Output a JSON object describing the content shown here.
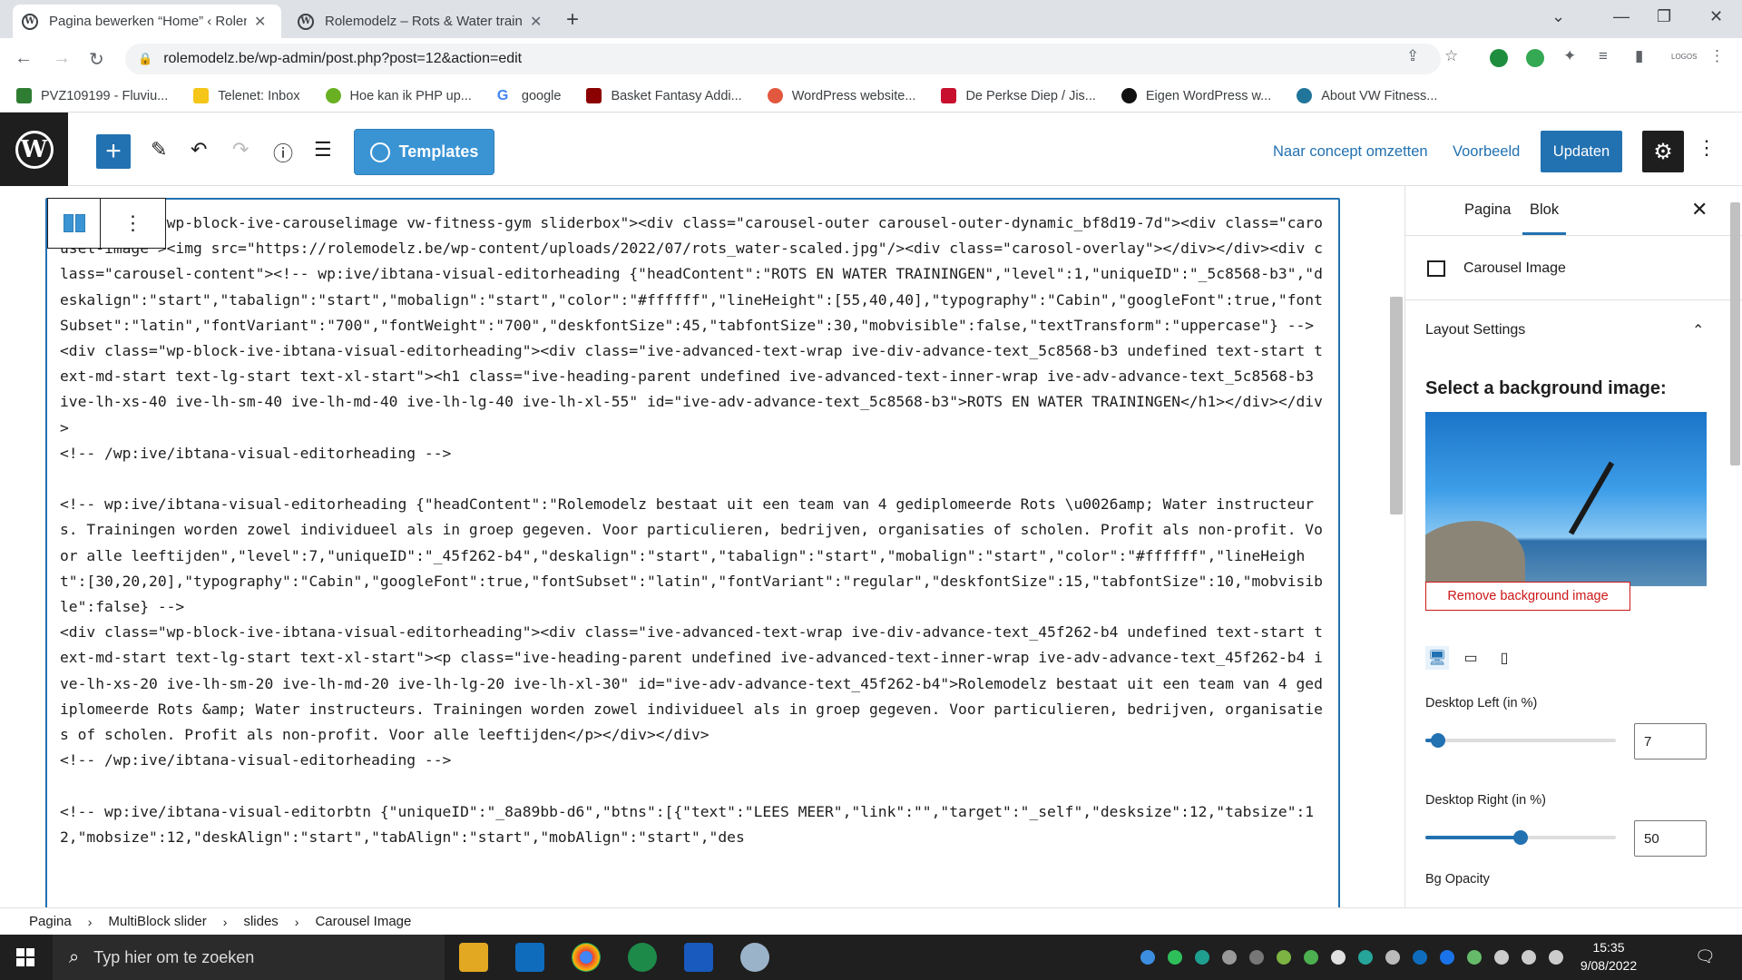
{
  "browser": {
    "tabs": [
      {
        "title": "Pagina bewerken “Home” ‹ Rolem",
        "active": true
      },
      {
        "title": "Rolemodelz – Rots & Water train",
        "active": false
      }
    ],
    "url": "rolemodelz.be/wp-admin/post.php?post=12&action=edit",
    "bookmarks": [
      {
        "label": "PVZ109199 - Fluviu...",
        "color": "#2e7d32"
      },
      {
        "label": "Telenet: Inbox",
        "color": "#f5c518"
      },
      {
        "label": "Hoe kan ik PHP up...",
        "color": "#6ab023"
      },
      {
        "label": "google",
        "color": "#4285f4"
      },
      {
        "label": "Basket Fantasy Addi...",
        "color": "#8b0000"
      },
      {
        "label": "WordPress website...",
        "color": "#e2583e"
      },
      {
        "label": "De Perkse Diep / Jis...",
        "color": "#c8102e"
      },
      {
        "label": "Eigen WordPress w...",
        "color": "#111111"
      },
      {
        "label": "About VW Fitness...",
        "color": "#21759b"
      }
    ]
  },
  "wp_toolbar": {
    "templates_label": "Templates",
    "draft_label": "Naar concept omzetten",
    "preview_label": "Voorbeeld",
    "update_label": "Updaten"
  },
  "editor": {
    "code": "<div class=\"wp-block-ive-carouselimage vw-fitness-gym sliderbox\"><div class=\"carousel-outer carousel-outer-dynamic_bf8d19-7d\"><div class=\"carousel-image\"><img src=\"https://rolemodelz.be/wp-content/uploads/2022/07/rots_water-scaled.jpg\"/><div class=\"carosol-overlay\"></div></div><div class=\"carousel-content\"><!-- wp:ive/ibtana-visual-editorheading {\"headContent\":\"ROTS EN WATER TRAININGEN\",\"level\":1,\"uniqueID\":\"_5c8568-b3\",\"deskalign\":\"start\",\"tabalign\":\"start\",\"mobalign\":\"start\",\"color\":\"#ffffff\",\"lineHeight\":[55,40,40],\"typography\":\"Cabin\",\"googleFont\":true,\"fontSubset\":\"latin\",\"fontVariant\":\"700\",\"fontWeight\":\"700\",\"deskfontSize\":45,\"tabfontSize\":30,\"mobvisible\":false,\"textTransform\":\"uppercase\"} -->\n<div class=\"wp-block-ive-ibtana-visual-editorheading\"><div class=\"ive-advanced-text-wrap ive-div-advance-text_5c8568-b3 undefined text-start text-md-start text-lg-start text-xl-start\"><h1 class=\"ive-heading-parent undefined ive-advanced-text-inner-wrap ive-adv-advance-text_5c8568-b3 ive-lh-xs-40 ive-lh-sm-40 ive-lh-md-40 ive-lh-lg-40 ive-lh-xl-55\" id=\"ive-adv-advance-text_5c8568-b3\">ROTS EN WATER TRAININGEN</h1></div></div>\n<!-- /wp:ive/ibtana-visual-editorheading -->\n\n<!-- wp:ive/ibtana-visual-editorheading {\"headContent\":\"Rolemodelz bestaat uit een team van 4 gediplomeerde Rots \\u0026amp; Water instructeurs. Trainingen worden zowel individueel als in groep gegeven. Voor particulieren, bedrijven, organisaties of scholen. Profit als non-profit. Voor alle leeftijden\",\"level\":7,\"uniqueID\":\"_45f262-b4\",\"deskalign\":\"start\",\"tabalign\":\"start\",\"mobalign\":\"start\",\"color\":\"#ffffff\",\"lineHeight\":[30,20,20],\"typography\":\"Cabin\",\"googleFont\":true,\"fontSubset\":\"latin\",\"fontVariant\":\"regular\",\"deskfontSize\":15,\"tabfontSize\":10,\"mobvisible\":false} -->\n<div class=\"wp-block-ive-ibtana-visual-editorheading\"><div class=\"ive-advanced-text-wrap ive-div-advance-text_45f262-b4 undefined text-start text-md-start text-lg-start text-xl-start\"><p class=\"ive-heading-parent undefined ive-advanced-text-inner-wrap ive-adv-advance-text_45f262-b4 ive-lh-xs-20 ive-lh-sm-20 ive-lh-md-20 ive-lh-lg-20 ive-lh-xl-30\" id=\"ive-adv-advance-text_45f262-b4\">Rolemodelz bestaat uit een team van 4 gediplomeerde Rots &amp; Water instructeurs. Trainingen worden zowel individueel als in groep gegeven. Voor particulieren, bedrijven, organisaties of scholen. Profit als non-profit. Voor alle leeftijden</p></div></div>\n<!-- /wp:ive/ibtana-visual-editorheading -->\n\n<!-- wp:ive/ibtana-visual-editorbtn {\"uniqueID\":\"_8a89bb-d6\",\"btns\":[{\"text\":\"LEES MEER\",\"link\":\"\",\"target\":\"_self\",\"desksize\":12,\"tabsize\":12,\"mobsize\":12,\"deskAlign\":\"start\",\"tabAlign\":\"start\",\"mobAlign\":\"start\",\"des"
  },
  "sidebar": {
    "tabs": [
      "Pagina",
      "Blok"
    ],
    "active_tab": "Blok",
    "block_name": "Carousel Image",
    "panel_title": "Layout Settings",
    "bg_heading": "Select a background image:",
    "remove_bg_label": "Remove background image",
    "desktop_left_label": "Desktop Left (in %)",
    "desktop_left_value": "7",
    "desktop_right_label": "Desktop Right (in %)",
    "desktop_right_value": "50",
    "bg_opacity_label": "Bg Opacity"
  },
  "breadcrumb": [
    "Pagina",
    "MultiBlock slider",
    "slides",
    "Carousel Image"
  ],
  "taskbar": {
    "search_placeholder": "Typ hier om te zoeken",
    "time": "15:35",
    "date": "9/08/2022"
  },
  "icons": {
    "back": "arrow-left-icon",
    "forward": "arrow-right-icon",
    "reload": "reload-icon",
    "undo": "undo-icon",
    "redo": "redo-icon",
    "info": "info-icon",
    "list": "list-view-icon",
    "settings": "gear-icon",
    "close": "close-icon"
  }
}
